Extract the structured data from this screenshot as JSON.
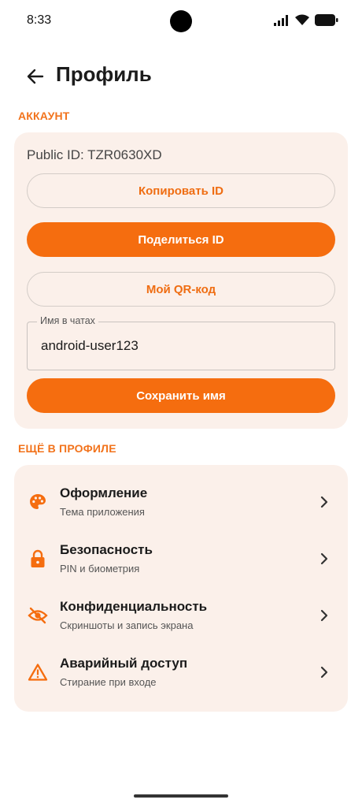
{
  "status_bar": {
    "time": "8:33"
  },
  "header": {
    "title": "Профиль"
  },
  "account_section": {
    "header": "АККАУНТ",
    "public_id": "Public ID: TZR0630XD",
    "copy_button": "Копировать ID",
    "share_button": "Поделиться ID",
    "qr_button": "Мой QR-код",
    "name_field": {
      "label": "Имя в чатах",
      "value": "android-user123"
    },
    "save_button": "Сохранить имя"
  },
  "more_section": {
    "header": "ЕЩЁ В ПРОФИЛЕ",
    "items": [
      {
        "title": "Оформление",
        "subtitle": "Тема приложения",
        "icon": "palette-icon"
      },
      {
        "title": "Безопасность",
        "subtitle": "PIN и биометрия",
        "icon": "lock-icon"
      },
      {
        "title": "Конфиденциальность",
        "subtitle": "Скриншоты и запись экрана",
        "icon": "eye-off-icon"
      },
      {
        "title": "Аварийный доступ",
        "subtitle": "Стирание при входе",
        "icon": "warning-icon"
      }
    ]
  },
  "colors": {
    "accent": "#f56d0f",
    "card_background": "#fbf0ea",
    "section_header": "#f2731c"
  }
}
